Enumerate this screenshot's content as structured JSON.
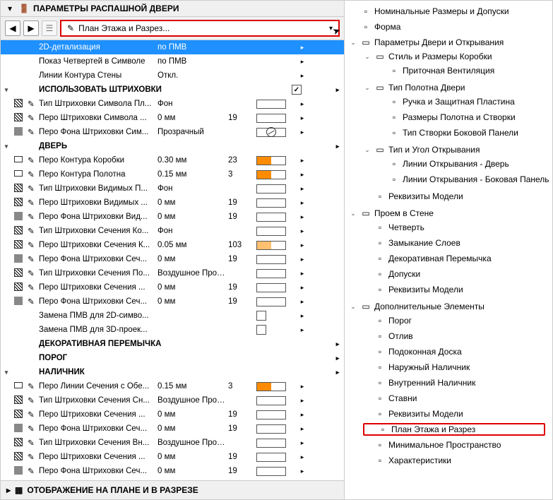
{
  "header": {
    "title": "ПАРАМЕТРЫ РАСПАШНОЙ ДВЕРИ"
  },
  "dropdown": {
    "label": "План Этажа и Разрез..."
  },
  "footer": {
    "label": "ОТОБРАЖЕНИЕ НА ПЛАНЕ И В РАЗРЕЗЕ"
  },
  "rows": [
    {
      "t": "sel",
      "label": "2D-детализация",
      "v1": "по ПМВ"
    },
    {
      "t": "plain",
      "label": "Показ Четвертей в Символе",
      "v1": "по ПМВ"
    },
    {
      "t": "plain",
      "label": "Линии Контура Стены",
      "v1": "Откл."
    },
    {
      "t": "grpchk",
      "exp": "▾",
      "label": "ИСПОЛЬЗОВАТЬ ШТРИХОВКИ",
      "chk": true
    },
    {
      "t": "param",
      "i": "hatch",
      "label": "Тип Штриховки Символа Пл...",
      "v1": "Фон",
      "sw": ""
    },
    {
      "t": "param",
      "i": "hatch",
      "label": "Перо Штриховки Символа ...",
      "v1": "0 мм",
      "v2": "19",
      "sw": ""
    },
    {
      "t": "param",
      "i": "gray",
      "label": "Перо Фона Штриховки Сим...",
      "v1": "Прозрачный",
      "sw": "slash"
    },
    {
      "t": "grp",
      "exp": "▾",
      "label": "ДВЕРЬ"
    },
    {
      "t": "param",
      "i": "rect",
      "label": "Перо Контура Коробки",
      "v1": "0.30 мм",
      "v2": "23",
      "sw": "half-orange"
    },
    {
      "t": "param",
      "i": "rect",
      "label": "Перо Контура Полотна",
      "v1": "0.15 мм",
      "v2": "3",
      "sw": "half-orange"
    },
    {
      "t": "param",
      "i": "hatch",
      "label": "Тип Штриховки Видимых П...",
      "v1": "Фон",
      "sw": ""
    },
    {
      "t": "param",
      "i": "hatch",
      "label": "Перо Штриховки Видимых ...",
      "v1": "0 мм",
      "v2": "19",
      "sw": ""
    },
    {
      "t": "param",
      "i": "gray",
      "label": "Перо Фона Штриховки Вид...",
      "v1": "0 мм",
      "v2": "19",
      "sw": ""
    },
    {
      "t": "param",
      "i": "hatch",
      "label": "Тип Штриховки Сечения Ко...",
      "v1": "Фон",
      "sw": ""
    },
    {
      "t": "param",
      "i": "hatch",
      "label": "Перо Штриховки Сечения К...",
      "v1": "0.05 мм",
      "v2": "103",
      "sw": "light-orange"
    },
    {
      "t": "param",
      "i": "gray",
      "label": "Перо Фона Штриховки Сеч...",
      "v1": "0 мм",
      "v2": "19",
      "sw": ""
    },
    {
      "t": "param",
      "i": "hatch",
      "label": "Тип Штриховки Сечения По...",
      "v1": "Воздушное Прост...",
      "sw": ""
    },
    {
      "t": "param",
      "i": "hatch",
      "label": "Перо Штриховки Сечения ...",
      "v1": "0 мм",
      "v2": "19",
      "sw": ""
    },
    {
      "t": "param",
      "i": "gray",
      "label": "Перо Фона Штриховки Сеч...",
      "v1": "0 мм",
      "v2": "19",
      "sw": ""
    },
    {
      "t": "chk",
      "label": "Замена ПМВ для 2D-симво...",
      "chk": false
    },
    {
      "t": "chk",
      "label": "Замена ПМВ для 3D-проек...",
      "chk": false
    },
    {
      "t": "grp",
      "label": "ДЕКОРАТИВНАЯ ПЕРЕМЫЧКА"
    },
    {
      "t": "grp",
      "label": "ПОРОГ"
    },
    {
      "t": "grp",
      "exp": "▾",
      "label": "НАЛИЧНИК"
    },
    {
      "t": "param",
      "i": "rect",
      "label": "Перо Линии Сечения с Обе...",
      "v1": "0.15 мм",
      "v2": "3",
      "sw": "half-orange"
    },
    {
      "t": "param",
      "i": "hatch",
      "label": "Тип Штриховки Сечения Сн...",
      "v1": "Воздушное Прост...",
      "sw": ""
    },
    {
      "t": "param",
      "i": "hatch",
      "label": "Перо Штриховки Сечения ...",
      "v1": "0 мм",
      "v2": "19",
      "sw": ""
    },
    {
      "t": "param",
      "i": "gray",
      "label": "Перо Фона Штриховки Сеч...",
      "v1": "0 мм",
      "v2": "19",
      "sw": ""
    },
    {
      "t": "param",
      "i": "hatch",
      "label": "Тип Штриховки Сечения Вн...",
      "v1": "Воздушное Прост...",
      "sw": ""
    },
    {
      "t": "param",
      "i": "hatch",
      "label": "Перо Штриховки Сечения ...",
      "v1": "0 мм",
      "v2": "19",
      "sw": ""
    },
    {
      "t": "param",
      "i": "gray",
      "label": "Перо Фона Штриховки Сеч...",
      "v1": "0 мм",
      "v2": "19",
      "sw": ""
    }
  ],
  "tree": {
    "top": [
      {
        "label": "Номинальные Размеры и Допуски",
        "leaf": true
      },
      {
        "label": "Форма",
        "leaf": true
      }
    ],
    "group": {
      "label": "Параметры Двери и Открывания",
      "open": true,
      "children": [
        {
          "label": "Стиль и Размеры Коробки",
          "open": true,
          "children": [
            {
              "label": "Приточная Вентиляция",
              "leaf": true
            }
          ]
        },
        {
          "label": "Тип Полотна Двери",
          "open": true,
          "children": [
            {
              "label": "Ручка и Защитная Пластина",
              "leaf": true
            },
            {
              "label": "Размеры Полотна и Створки",
              "leaf": true
            },
            {
              "label": "Тип Створки Боковой Панели",
              "leaf": true
            }
          ]
        },
        {
          "label": "Тип и Угол Открывания",
          "open": true,
          "children": [
            {
              "label": "Линии Открывания - Дверь",
              "leaf": true
            },
            {
              "label": "Линии Открывания - Боковая Панель",
              "leaf": true
            }
          ]
        },
        {
          "label": "Реквизиты Модели",
          "leaf": true
        }
      ]
    },
    "group2": {
      "label": "Проем в Стене",
      "open": true,
      "children": [
        {
          "label": "Четверть",
          "leaf": true
        },
        {
          "label": "Замыкание Слоев",
          "leaf": true
        },
        {
          "label": "Декоративная Перемычка",
          "leaf": true
        },
        {
          "label": "Допуски",
          "leaf": true
        },
        {
          "label": "Реквизиты Модели",
          "leaf": true
        }
      ]
    },
    "group3": {
      "label": "Дополнительные Элементы",
      "open": true,
      "children": [
        {
          "label": "Порог",
          "leaf": true
        },
        {
          "label": "Отлив",
          "leaf": true
        },
        {
          "label": "Подоконная Доска",
          "leaf": true
        },
        {
          "label": "Наружный Наличник",
          "leaf": true
        },
        {
          "label": "Внутренний Наличник",
          "leaf": true
        },
        {
          "label": "Ставни",
          "leaf": true
        },
        {
          "label": "Реквизиты Модели",
          "leaf": true
        },
        {
          "label": "План Этажа и Разрез",
          "leaf": true,
          "hl": true
        },
        {
          "label": "Минимальное Пространство",
          "leaf": true
        },
        {
          "label": "Характеристики",
          "leaf": true
        }
      ]
    }
  }
}
